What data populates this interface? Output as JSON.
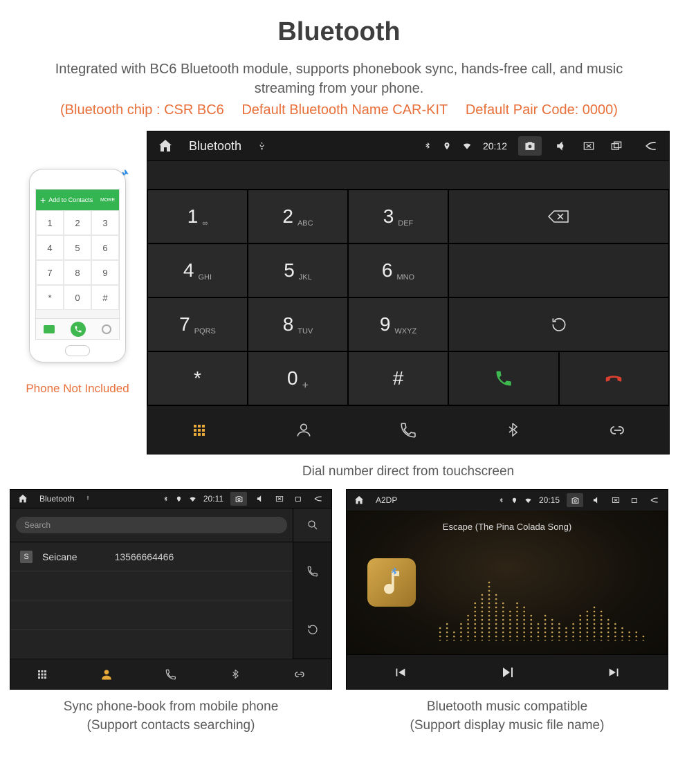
{
  "page": {
    "title": "Bluetooth",
    "subtitle": "Integrated with BC6 Bluetooth module, supports phonebook sync, hands-free call, and music streaming from your phone.",
    "spec_chip": "(Bluetooth chip : CSR BC6",
    "spec_name": "Default Bluetooth Name CAR-KIT",
    "spec_pair": "Default Pair Code: 0000)"
  },
  "phone": {
    "add_contacts": "Add to Contacts",
    "more": "MORE",
    "caption": "Phone Not Included",
    "keys": [
      "1",
      "2",
      "3",
      "4",
      "5",
      "6",
      "7",
      "8",
      "9",
      "*",
      "0",
      "#"
    ]
  },
  "dialer": {
    "top": {
      "title": "Bluetooth",
      "time": "20:12"
    },
    "keys": [
      {
        "n": "1",
        "s": "∞"
      },
      {
        "n": "2",
        "s": "ABC"
      },
      {
        "n": "3",
        "s": "DEF"
      },
      {
        "n": "4",
        "s": "GHI"
      },
      {
        "n": "5",
        "s": "JKL"
      },
      {
        "n": "6",
        "s": "MNO"
      },
      {
        "n": "7",
        "s": "PQRS"
      },
      {
        "n": "8",
        "s": "TUV"
      },
      {
        "n": "9",
        "s": "WXYZ"
      },
      {
        "n": "*",
        "s": ""
      },
      {
        "n": "0",
        "s": "+"
      },
      {
        "n": "#",
        "s": ""
      }
    ],
    "caption": "Dial number direct from touchscreen"
  },
  "phonebook": {
    "top": {
      "title": "Bluetooth",
      "time": "20:11"
    },
    "search_placeholder": "Search",
    "contact": {
      "letter": "S",
      "name": "Seicane",
      "number": "13566664466"
    },
    "caption_l1": "Sync phone-book from mobile phone",
    "caption_l2": "(Support contacts searching)"
  },
  "music": {
    "top": {
      "title": "A2DP",
      "time": "20:15"
    },
    "song": "Escape (The Pina Colada Song)",
    "caption_l1": "Bluetooth music compatible",
    "caption_l2": "(Support display music file name)"
  }
}
